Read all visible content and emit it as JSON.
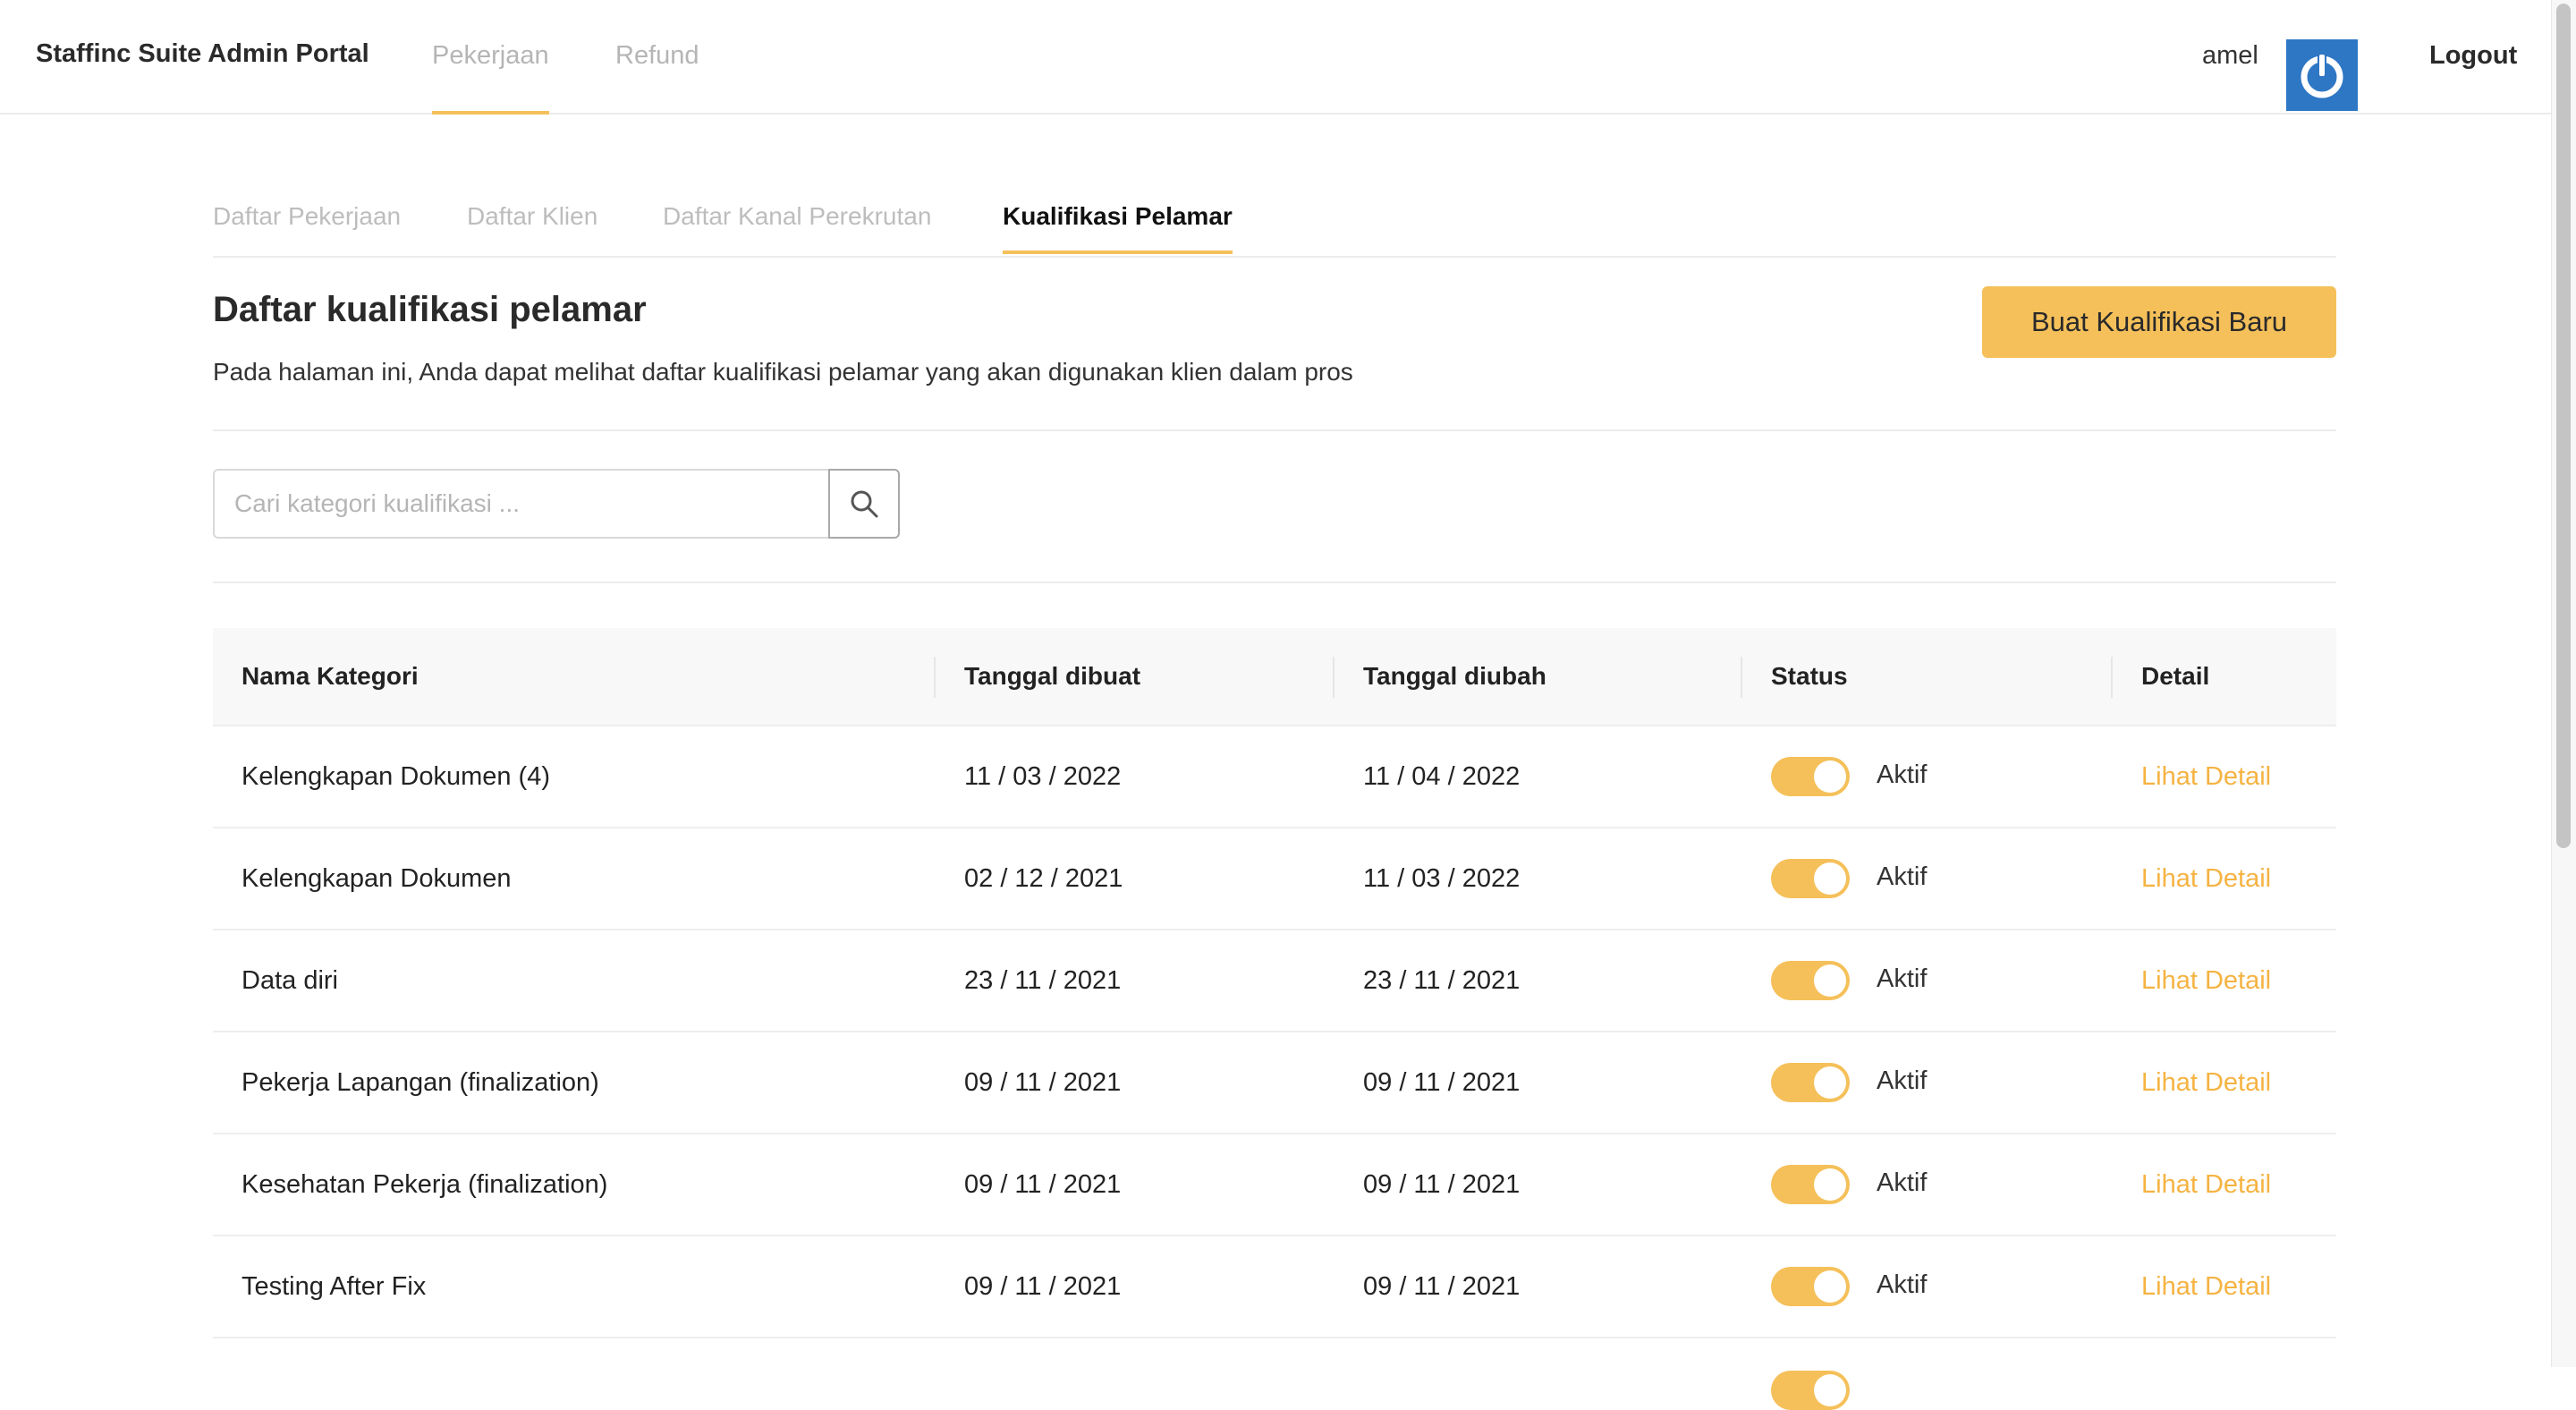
{
  "header": {
    "brand": "Staffinc Suite Admin Portal",
    "nav": [
      {
        "label": "Pekerjaan",
        "active": true
      },
      {
        "label": "Refund",
        "active": false
      }
    ],
    "username": "amel",
    "logout_label": "Logout"
  },
  "subtabs": [
    {
      "label": "Daftar Pekerjaan",
      "active": false
    },
    {
      "label": "Daftar Klien",
      "active": false
    },
    {
      "label": "Daftar Kanal Perekrutan",
      "active": false
    },
    {
      "label": "Kualifikasi Pelamar",
      "active": true
    }
  ],
  "page": {
    "title": "Daftar kualifikasi pelamar",
    "description": "Pada halaman ini, Anda dapat melihat daftar kualifikasi pelamar yang akan digunakan klien dalam pros",
    "create_button": "Buat Kualifikasi Baru"
  },
  "search": {
    "placeholder": "Cari kategori kualifikasi ...",
    "value": ""
  },
  "table": {
    "headers": [
      "Nama Kategori",
      "Tanggal dibuat",
      "Tanggal diubah",
      "Status",
      "Detail"
    ],
    "rows": [
      {
        "name": "Kelengkapan Dokumen (4)",
        "created": "11 / 03 / 2022",
        "updated": "11 / 04 / 2022",
        "status": "Aktif",
        "active": true,
        "detail": "Lihat Detail"
      },
      {
        "name": "Kelengkapan Dokumen",
        "created": "02 / 12 / 2021",
        "updated": "11 / 03 / 2022",
        "status": "Aktif",
        "active": true,
        "detail": "Lihat Detail"
      },
      {
        "name": "Data diri",
        "created": "23 / 11 / 2021",
        "updated": "23 / 11 / 2021",
        "status": "Aktif",
        "active": true,
        "detail": "Lihat Detail"
      },
      {
        "name": "Pekerja Lapangan (finalization)",
        "created": "09 / 11 / 2021",
        "updated": "09 / 11 / 2021",
        "status": "Aktif",
        "active": true,
        "detail": "Lihat Detail"
      },
      {
        "name": "Kesehatan Pekerja (finalization)",
        "created": "09 / 11 / 2021",
        "updated": "09 / 11 / 2021",
        "status": "Aktif",
        "active": true,
        "detail": "Lihat Detail"
      },
      {
        "name": "Testing After Fix",
        "created": "09 / 11 / 2021",
        "updated": "09 / 11 / 2021",
        "status": "Aktif",
        "active": true,
        "detail": "Lihat Detail"
      }
    ]
  },
  "colors": {
    "accent": "#f5c05a",
    "link": "#f5b342",
    "avatar_bg": "#2e77c4"
  },
  "icons": [
    "power-icon",
    "search-icon"
  ]
}
